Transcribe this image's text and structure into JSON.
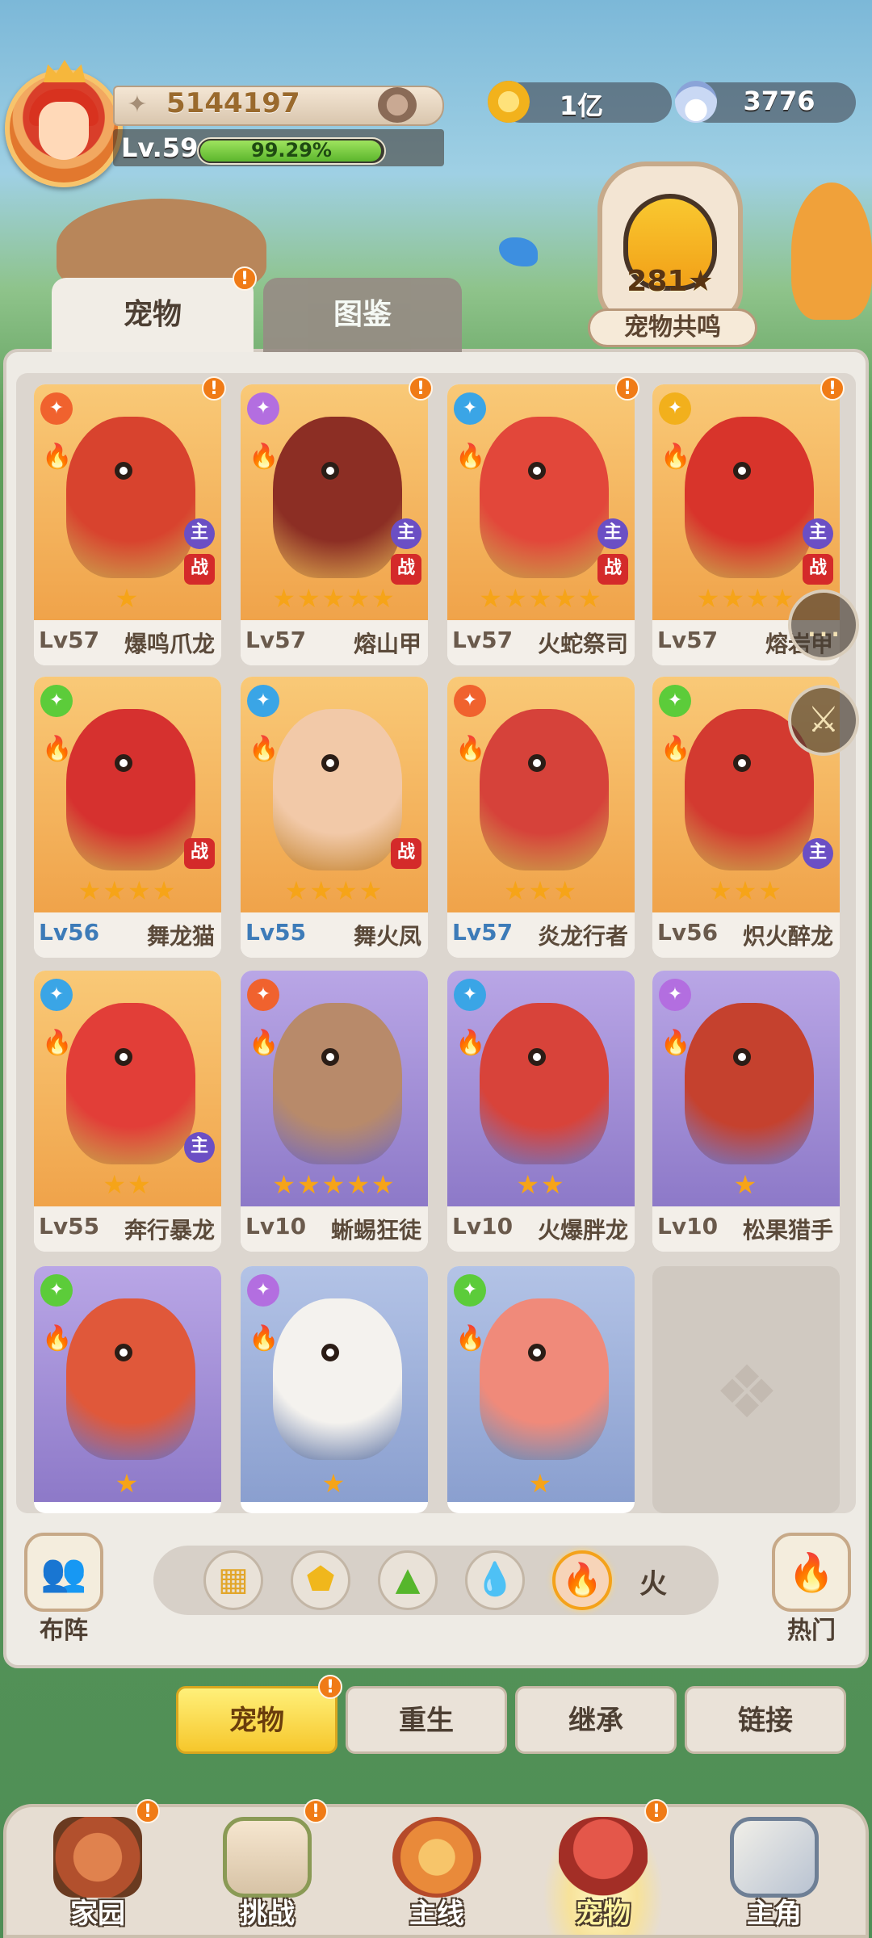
{
  "header": {
    "power": "5144197",
    "level": "Lv.59",
    "exp_fraction": 0.9929,
    "exp_text": "99.29%",
    "gold": "1亿",
    "shells": "3776",
    "icons": {
      "gold": "gold-coin-icon",
      "shells": "shell-icon",
      "power": "power-wings-icon",
      "rank": "lion-rank-icon"
    }
  },
  "resonance": {
    "count": "281",
    "label": "宠物共鸣"
  },
  "tabs": [
    {
      "label": "宠物"
    },
    {
      "label": "图鉴"
    }
  ],
  "pets": [
    {
      "level": "Lv57",
      "name": "爆鸣爪龙",
      "stars": 1,
      "role_color": "#f0622e",
      "flags": [
        "主",
        "战"
      ],
      "alert": true,
      "bg": "orange",
      "body": "#d8432e"
    },
    {
      "level": "Lv57",
      "name": "熔山甲",
      "stars": 5,
      "role_color": "#b36ee0",
      "flags": [
        "主",
        "战"
      ],
      "alert": true,
      "bg": "orange",
      "body": "#8c2e24"
    },
    {
      "level": "Lv57",
      "name": "火蛇祭司",
      "stars": 5,
      "role_color": "#3aa5e6",
      "flags": [
        "主",
        "战"
      ],
      "alert": true,
      "bg": "orange",
      "body": "#e2473a"
    },
    {
      "level": "Lv57",
      "name": "熔岩甲",
      "stars": 4,
      "role_color": "#f2b01c",
      "flags": [
        "主",
        "战"
      ],
      "alert": true,
      "bg": "orange",
      "body": "#d8342b"
    },
    {
      "level": "Lv56",
      "name": "舞龙猫",
      "stars": 4,
      "role_color": "#5ccc3a",
      "flags": [
        "战"
      ],
      "alert": false,
      "bg": "orange",
      "body": "#d6312f",
      "blue": true
    },
    {
      "level": "Lv55",
      "name": "舞火凤",
      "stars": 4,
      "role_color": "#3aa5e6",
      "flags": [
        "战"
      ],
      "alert": false,
      "bg": "orange",
      "body": "#f2c9a8",
      "blue": true
    },
    {
      "level": "Lv57",
      "name": "炎龙行者",
      "stars": 3,
      "role_color": "#f0622e",
      "flags": [],
      "alert": false,
      "bg": "orange",
      "body": "#d6423a",
      "blue": true
    },
    {
      "level": "Lv56",
      "name": "炽火醉龙",
      "stars": 3,
      "role_color": "#5ccc3a",
      "flags": [
        "主"
      ],
      "alert": false,
      "bg": "orange",
      "body": "#d33a30"
    },
    {
      "level": "Lv55",
      "name": "奔行暴龙",
      "stars": 2,
      "role_color": "#3aa5e6",
      "flags": [
        "主"
      ],
      "alert": false,
      "bg": "orange",
      "body": "#e23e38"
    },
    {
      "level": "Lv10",
      "name": "蜥蜴狂徒",
      "stars": 5,
      "role_color": "#f0622e",
      "flags": [],
      "alert": false,
      "bg": "purple",
      "body": "#b88a6a"
    },
    {
      "level": "Lv10",
      "name": "火爆胖龙",
      "stars": 2,
      "role_color": "#3aa5e6",
      "flags": [],
      "alert": false,
      "bg": "purple",
      "body": "#d8433a"
    },
    {
      "level": "Lv10",
      "name": "松果猎手",
      "stars": 1,
      "role_color": "#b36ee0",
      "flags": [],
      "alert": false,
      "bg": "purple",
      "body": "#c5412e"
    },
    {
      "level": "",
      "name": "",
      "stars": 1,
      "role_color": "#5ccc3a",
      "flags": [],
      "alert": false,
      "bg": "purple",
      "body": "#e0583a"
    },
    {
      "level": "",
      "name": "",
      "stars": 1,
      "role_color": "#b36ee0",
      "flags": [],
      "alert": false,
      "bg": "blue",
      "body": "#f4f2ee"
    },
    {
      "level": "",
      "name": "",
      "stars": 1,
      "role_color": "#5ccc3a",
      "flags": [],
      "alert": false,
      "bg": "blue",
      "body": "#f08a7a"
    }
  ],
  "side_buttons": {
    "formation": "布阵",
    "hot": "热门"
  },
  "element_filter": {
    "items": [
      "grid-all-icon",
      "earth-icon",
      "grass-icon",
      "water-icon",
      "fire-icon"
    ],
    "selected_label": "火"
  },
  "sub_tabs": [
    {
      "label": "宠物",
      "active": true
    },
    {
      "label": "重生"
    },
    {
      "label": "继承"
    },
    {
      "label": "链接"
    }
  ],
  "nav": [
    {
      "label": "家园"
    },
    {
      "label": "挑战"
    },
    {
      "label": "主线"
    },
    {
      "label": "宠物",
      "active": true
    },
    {
      "label": "主角"
    }
  ],
  "colors": {
    "accent": "#f6c72c",
    "alert": "#f07b16",
    "fire": "#e0401d"
  }
}
